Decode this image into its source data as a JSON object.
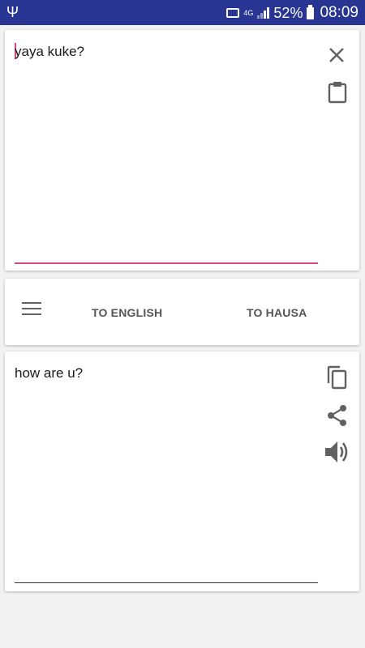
{
  "status_bar": {
    "network": "4G",
    "battery_percent": "52%",
    "time": "08:09"
  },
  "input": {
    "text": "yaya kuke?"
  },
  "toolbar": {
    "to_english_label": "TO ENGLISH",
    "to_hausa_label": "TO HAUSA"
  },
  "output": {
    "text": "how are u?"
  },
  "colors": {
    "status_bar": "#283593",
    "accent": "#d64a7a"
  },
  "icons": [
    "usb-icon",
    "cast-icon",
    "signal-icon",
    "battery-icon",
    "close-icon",
    "clipboard-icon",
    "menu-icon",
    "copy-icon",
    "share-icon",
    "volume-icon"
  ]
}
